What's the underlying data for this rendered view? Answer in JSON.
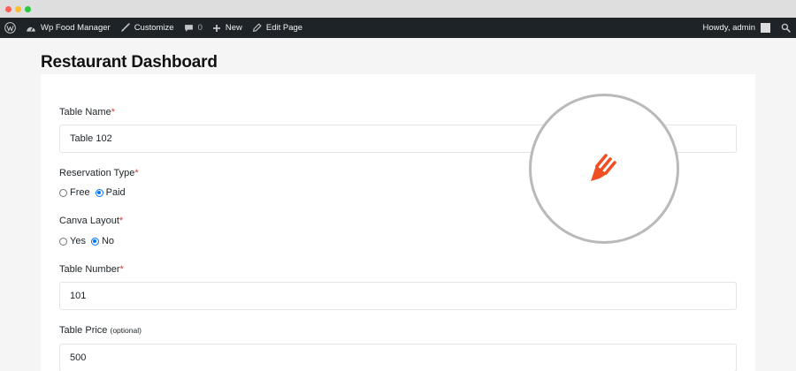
{
  "browser": {
    "controls": [
      {
        "name": "close",
        "color": "#ff5f57"
      },
      {
        "name": "minimize",
        "color": "#febc2e"
      },
      {
        "name": "maximize",
        "color": "#28c840"
      }
    ]
  },
  "adminbar": {
    "site_name": "Wp Food Manager",
    "customize": "Customize",
    "comments_count": "0",
    "new": "New",
    "edit_page": "Edit Page",
    "howdy": "Howdy, admin"
  },
  "page": {
    "title": "Restaurant Dashboard"
  },
  "form": {
    "required_mark": "*",
    "table_name": {
      "label": "Table Name",
      "value": "Table 102"
    },
    "reservation_type": {
      "label": "Reservation Type",
      "options": [
        {
          "label": "Free",
          "checked": false
        },
        {
          "label": "Paid",
          "checked": true
        }
      ]
    },
    "canva_layout": {
      "label": "Canva Layout",
      "options": [
        {
          "label": "Yes",
          "checked": false
        },
        {
          "label": "No",
          "checked": true
        }
      ]
    },
    "table_number": {
      "label": "Table Number",
      "value": "101"
    },
    "table_price": {
      "label": "Table Price",
      "optional": "(optional)",
      "value": "500"
    }
  },
  "colors": {
    "accent": "#0075ff",
    "required": "#d63638",
    "loader_icon": "#f04e23"
  }
}
